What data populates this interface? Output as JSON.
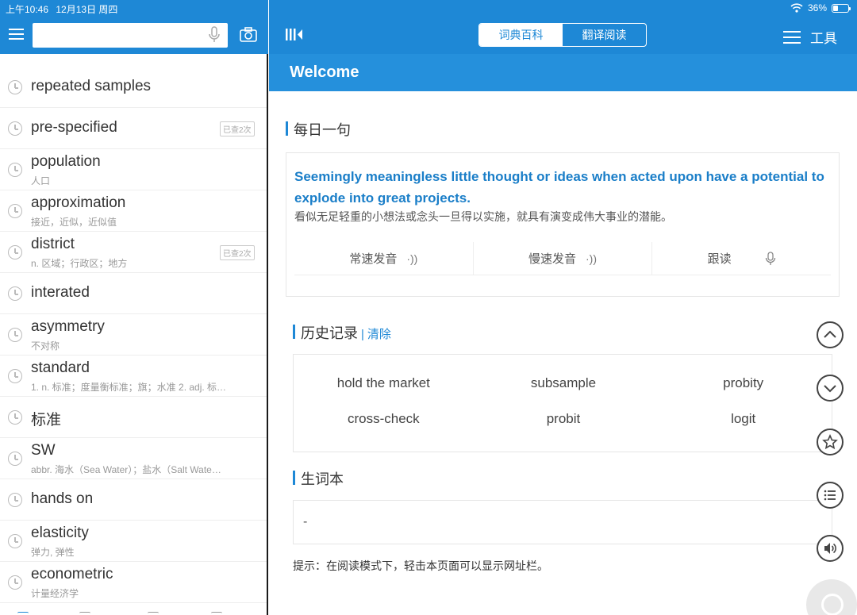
{
  "status": {
    "time": "上午10:46",
    "date": "12月13日 周四",
    "battery": "36%",
    "battery_level": 0.36
  },
  "search": {
    "placeholder": "",
    "value": ""
  },
  "history_list": [
    {
      "word": "repeated samples",
      "def": "",
      "badge": ""
    },
    {
      "word": "pre-specified",
      "def": "",
      "badge": "已查2次"
    },
    {
      "word": "population",
      "def": "人口",
      "badge": ""
    },
    {
      "word": "approximation",
      "def": "接近，近似，近似值",
      "badge": ""
    },
    {
      "word": "district",
      "def": "n. 区域；行政区；地方",
      "badge": "已查2次"
    },
    {
      "word": "interated",
      "def": "",
      "badge": ""
    },
    {
      "word": "asymmetry",
      "def": "不对称",
      "badge": ""
    },
    {
      "word": "standard",
      "def": "1. n. 标准；度量衡标准；旗；水准 2. adj. 标…",
      "badge": ""
    },
    {
      "word": "标准",
      "def": "",
      "badge": ""
    },
    {
      "word": "SW",
      "def": "abbr. 海水（Sea Water）；盐水（Salt Wate…",
      "badge": ""
    },
    {
      "word": "hands on",
      "def": "",
      "badge": ""
    },
    {
      "word": "elasticity",
      "def": "弹力, 弹性",
      "badge": ""
    },
    {
      "word": "econometric",
      "def": "计量经济学",
      "badge": ""
    }
  ],
  "header": {
    "tab_dictionary": "词典百科",
    "tab_translate": "翻译阅读",
    "tools": "工具",
    "welcome": "Welcome"
  },
  "daily": {
    "title": "每日一句",
    "en": "Seemingly meaningless little thought or ideas when acted upon have a potential to explode into great projects.",
    "zh": "看似无足轻重的小想法或念头一旦得以实施，就具有演变成伟大事业的潜能。",
    "normal_speed": "常速发音",
    "slow_speed": "慢速发音",
    "follow": "跟读"
  },
  "history": {
    "title": "历史记录",
    "clear": "清除",
    "separator": "|",
    "words": [
      "hold the market",
      "subsample",
      "probity",
      "cross-check",
      "probit",
      "logit"
    ]
  },
  "notebook": {
    "title": "生词本",
    "value": "-"
  },
  "tip": "提示：在阅读模式下，轻击本页面可以显示网址栏。",
  "colors": {
    "brand": "#1e88d6",
    "accent_text": "#1a7ec8"
  }
}
